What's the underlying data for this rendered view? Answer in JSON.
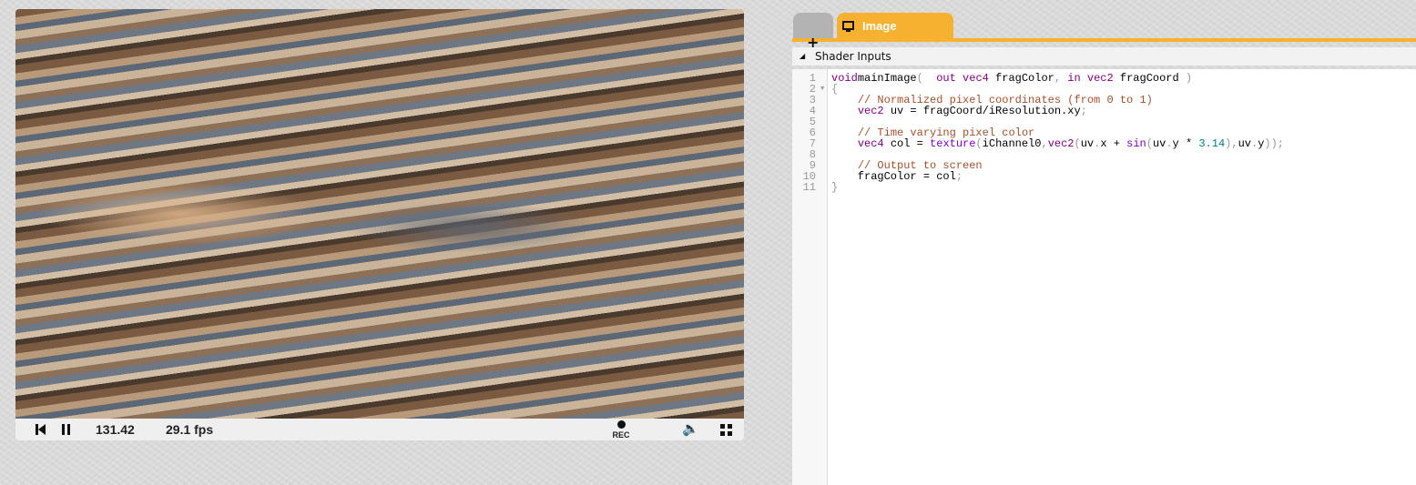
{
  "player": {
    "time": "131.42",
    "fps": "29.1 fps",
    "rec_label": "REC"
  },
  "tabs": [
    {
      "label": ""
    },
    {
      "label": "Image",
      "icon": "monitor-icon"
    }
  ],
  "shader_inputs": {
    "label": "Shader Inputs"
  },
  "colors": {
    "accent": "#f7b130"
  },
  "code": {
    "lines": [
      {
        "n": "1",
        "t": [
          [
            "kw",
            "void"
          ],
          [
            "",
            "mainImage"
          ],
          [
            "pu",
            "("
          ],
          [
            "",
            "  "
          ],
          [
            "kw",
            "out vec4"
          ],
          [
            "",
            "",
            " "
          ],
          [
            "",
            "fragColor"
          ],
          [
            "pu",
            ","
          ],
          [
            "",
            "",
            " "
          ],
          [
            "kw",
            "in vec2"
          ],
          [
            "",
            "",
            " "
          ],
          [
            "",
            "fragCoord "
          ],
          [
            "pu",
            ")"
          ]
        ]
      },
      {
        "n": "2",
        "t": [
          [
            "pu",
            "{"
          ]
        ]
      },
      {
        "n": "3",
        "t": [
          [
            "",
            "    "
          ],
          [
            "cm",
            "// Normalized pixel coordinates (from 0 to 1)"
          ]
        ]
      },
      {
        "n": "4",
        "t": [
          [
            "",
            "    "
          ],
          [
            "kw",
            "vec2"
          ],
          [
            "",
            " uv = fragCoord/iResolution.xy"
          ],
          [
            "pu",
            ";"
          ]
        ]
      },
      {
        "n": "5",
        "t": []
      },
      {
        "n": "6",
        "t": [
          [
            "",
            "    "
          ],
          [
            "cm",
            "// Time varying pixel color"
          ]
        ]
      },
      {
        "n": "7",
        "t": [
          [
            "",
            "    "
          ],
          [
            "kw",
            "vec4"
          ],
          [
            "",
            " col = "
          ],
          [
            "fn",
            "texture"
          ],
          [
            "pu",
            "("
          ],
          [
            "",
            "iChannel0"
          ],
          [
            "pu",
            ","
          ],
          [
            "kw",
            "vec2"
          ],
          [
            "pu",
            "("
          ],
          [
            "",
            "uv"
          ],
          [
            "pu",
            "."
          ],
          [
            "",
            "x + "
          ],
          [
            "fn",
            "sin"
          ],
          [
            "pu",
            "("
          ],
          [
            "",
            "uv"
          ],
          [
            "pu",
            "."
          ],
          [
            "",
            "y * "
          ],
          [
            "nm",
            "3.14"
          ],
          [
            "pu",
            "),"
          ],
          [
            "",
            "uv"
          ],
          [
            "pu",
            "."
          ],
          [
            "",
            "y"
          ],
          [
            "pu",
            "));"
          ]
        ]
      },
      {
        "n": "8",
        "t": []
      },
      {
        "n": "9",
        "t": [
          [
            "",
            "    "
          ],
          [
            "cm",
            "// Output to screen"
          ]
        ]
      },
      {
        "n": "10",
        "t": [
          [
            "",
            "    fragColor = col"
          ],
          [
            "pu",
            ";"
          ]
        ]
      },
      {
        "n": "11",
        "t": [
          [
            "pu",
            "}"
          ]
        ]
      }
    ]
  }
}
